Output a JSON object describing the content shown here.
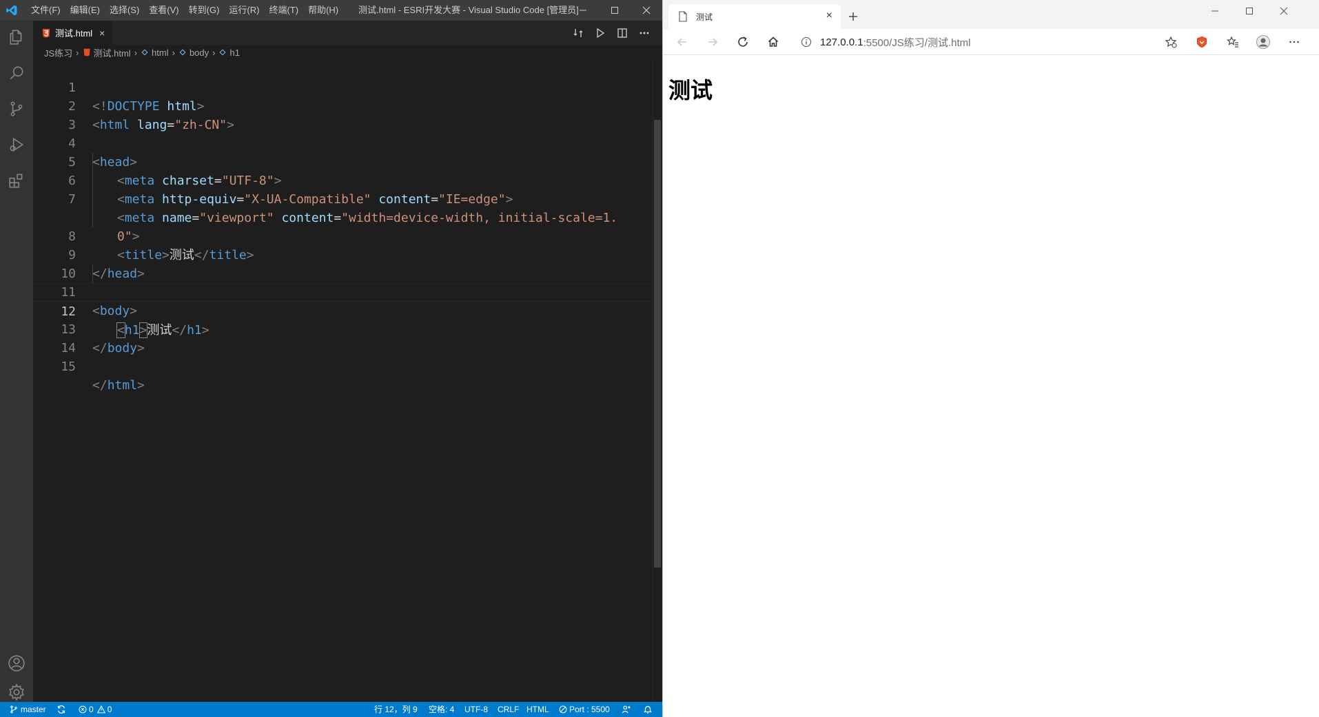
{
  "vscode": {
    "menu": [
      "文件(F)",
      "编辑(E)",
      "选择(S)",
      "查看(V)",
      "转到(G)",
      "运行(R)",
      "终端(T)",
      "帮助(H)"
    ],
    "window_title": "测试.html - ESRI开发大赛 - Visual Studio Code [管理员]",
    "tab": {
      "label": "测试.html",
      "close": "×"
    },
    "breadcrumbs": [
      "JS练习",
      "测试.html",
      "html",
      "body",
      "h1"
    ],
    "code": {
      "current_line": 12,
      "lines": [
        {
          "n": "1"
        },
        {
          "n": "2"
        },
        {
          "n": "3"
        },
        {
          "n": "4"
        },
        {
          "n": "5"
        },
        {
          "n": "6"
        },
        {
          "n": "7"
        },
        {
          "n": ""
        },
        {
          "n": "8"
        },
        {
          "n": "9"
        },
        {
          "n": "10"
        },
        {
          "n": "11"
        },
        {
          "n": "12"
        },
        {
          "n": "13"
        },
        {
          "n": "14"
        },
        {
          "n": "15"
        }
      ],
      "tokens": {
        "l1": [
          "<!",
          "DOCTYPE",
          " ",
          "html",
          ">"
        ],
        "l2": [
          "<",
          "html",
          " ",
          "lang",
          "=",
          "\"zh-CN\"",
          ">"
        ],
        "l4": [
          "<",
          "head",
          ">"
        ],
        "l5": [
          "<",
          "meta",
          " ",
          "charset",
          "=",
          "\"UTF-8\"",
          ">"
        ],
        "l6": [
          "<",
          "meta",
          " ",
          "http-equiv",
          "=",
          "\"X-UA-Compatible\"",
          " ",
          "content",
          "=",
          "\"IE=edge\"",
          ">"
        ],
        "l7": [
          "<",
          "meta",
          " ",
          "name",
          "=",
          "\"viewport\"",
          " ",
          "content",
          "=",
          "\"width=device-width, initial-scale=1."
        ],
        "l7b": [
          "0\"",
          ">"
        ],
        "l8": [
          "<",
          "title",
          ">",
          "测试",
          "</",
          "title",
          ">"
        ],
        "l9": [
          "</",
          "head",
          ">"
        ],
        "l11": [
          "<",
          "body",
          ">"
        ],
        "l12": [
          "<",
          "h1",
          ">",
          "测试",
          "</",
          "h1",
          ">"
        ],
        "l13": [
          "</",
          "body",
          ">"
        ],
        "l15": [
          "</",
          "html",
          ">"
        ]
      }
    },
    "status": {
      "branch": "master",
      "errors": "0",
      "warnings": "0",
      "position": "行 12，列 9",
      "spaces": "空格: 4",
      "encoding": "UTF-8",
      "eol": "CRLF",
      "language": "HTML",
      "port": "Port : 5500"
    }
  },
  "browser": {
    "tab_title": "测试",
    "tab_close": "×",
    "address_host": "127.0.0.1",
    "address_path": ":5500/JS练习/测试.html",
    "page_heading": "测试"
  },
  "colors": {
    "vscode_bg": "#1e1e1e",
    "statusbar": "#007acc",
    "tag": "#569cd6",
    "attr": "#9cdcfe",
    "string": "#ce9178"
  }
}
